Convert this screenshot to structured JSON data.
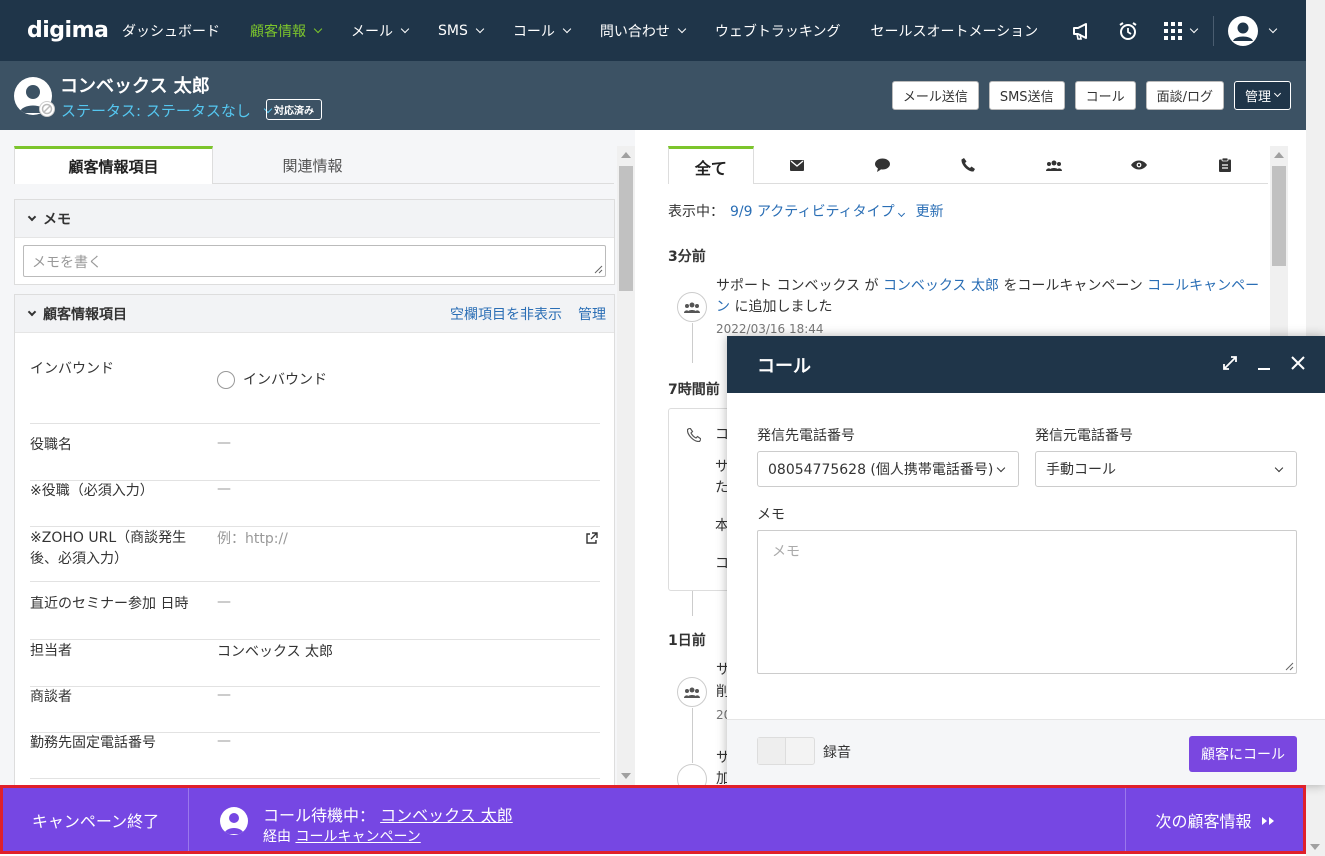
{
  "app": {
    "logo": "digima"
  },
  "nav": {
    "items": [
      {
        "label": "ダッシュボード",
        "dropdown": false,
        "active": false
      },
      {
        "label": "顧客情報",
        "dropdown": true,
        "active": true
      },
      {
        "label": "メール",
        "dropdown": true,
        "active": false
      },
      {
        "label": "SMS",
        "dropdown": true,
        "active": false
      },
      {
        "label": "コール",
        "dropdown": true,
        "active": false
      },
      {
        "label": "問い合わせ",
        "dropdown": true,
        "active": false
      },
      {
        "label": "ウェブトラッキング",
        "dropdown": false,
        "active": false
      },
      {
        "label": "セールスオートメーション",
        "dropdown": false,
        "active": false
      }
    ],
    "icons": [
      "megaphone-icon",
      "alarm-clock-icon",
      "apps-grid-icon",
      "user-avatar-icon"
    ]
  },
  "header": {
    "customer_name": "コンベックス 太郎",
    "status_label": "ステータス: ステータスなし",
    "badge": "対応済み",
    "buttons": [
      "メール送信",
      "SMS送信",
      "コール",
      "面談/ログ",
      "管理"
    ]
  },
  "left": {
    "tabs": [
      "顧客情報項目",
      "関連情報"
    ],
    "memo_title": "メモ",
    "memo_placeholder": "メモを書く",
    "info_title": "顧客情報項目",
    "hide_empty_link": "空欄項目を非表示",
    "manage_link": "管理",
    "fields": [
      {
        "label": "インバウンド",
        "value": "インバウンド",
        "type": "radio"
      },
      {
        "label": "役職名",
        "value": "—"
      },
      {
        "label": "※役職（必須入力）",
        "value": "—"
      },
      {
        "label": "※ZOHO URL（商談発生後、必須入力）",
        "value": "例：http://",
        "type": "url"
      },
      {
        "label": "直近のセミナー参加 日時",
        "value": "—"
      },
      {
        "label": "担当者",
        "value": "コンベックス 太郎"
      },
      {
        "label": "商談者",
        "value": "—"
      },
      {
        "label": "勤務先固定電話番号",
        "value": "—"
      }
    ]
  },
  "right": {
    "tabs": [
      {
        "label": "全て",
        "icon": ""
      },
      {
        "label": "",
        "icon": "mail-icon"
      },
      {
        "label": "",
        "icon": "chat-icon"
      },
      {
        "label": "",
        "icon": "phone-icon"
      },
      {
        "label": "",
        "icon": "group-icon"
      },
      {
        "label": "",
        "icon": "eye-icon"
      },
      {
        "label": "",
        "icon": "clipboard-icon"
      }
    ],
    "filter_prefix": "表示中：",
    "filter_link": "9/9 アクティビティタイプ",
    "refresh_link": "更新",
    "timeline": {
      "g1_head": "3分前",
      "g1_text_a": "サポート コンベックス が ",
      "g1_link_name": "コンベックス 太郎",
      "g1_text_b": " をコールキャンペーン ",
      "g1_link_campaign": "コールキャンペーン",
      "g1_text_c": " に追加しました",
      "g1_date": "2022/03/16 18:44",
      "g2_head": "7時間前",
      "g2_fragments": [
        "コ",
        "サ",
        "た",
        "本",
        "コ"
      ],
      "g3_head": "1日前",
      "g3_fragments": [
        "サ",
        "削",
        "20",
        "サ",
        "加"
      ]
    }
  },
  "dialog": {
    "title": "コール",
    "to_label": "発信先電話番号",
    "to_value": "08054775628 (個人携帯電話番号)",
    "from_label": "発信元電話番号",
    "from_value": "手動コール",
    "memo_label": "メモ",
    "memo_placeholder": "メモ",
    "record_label": "録音",
    "call_button": "顧客にコール"
  },
  "bottombar": {
    "end_campaign": "キャンペーン終了",
    "waiting_prefix": "コール待機中：",
    "waiting_name": "コンベックス 太郎",
    "via_prefix": "経由",
    "via_campaign": "コールキャンペーン",
    "next_label": "次の顧客情報"
  },
  "colors": {
    "nav_bg": "#1f3549",
    "header_bg": "#3c5264",
    "accent_green": "#7cc52c",
    "status_cyan": "#55c7f0",
    "purple": "#7647e3",
    "highlight_red": "#e0202b"
  }
}
